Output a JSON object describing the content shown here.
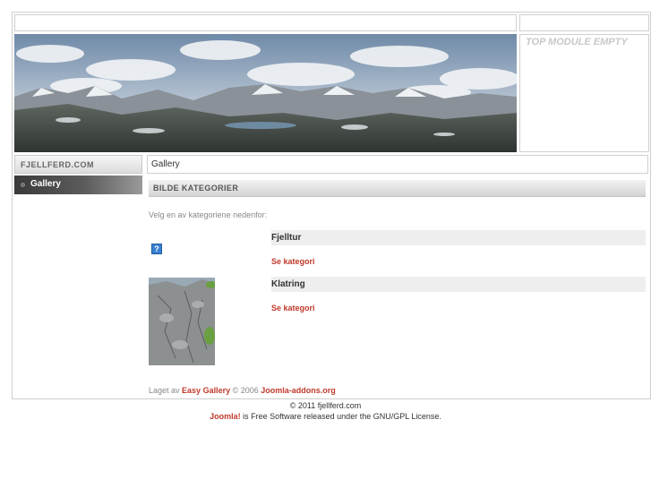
{
  "top_module": {
    "text": "TOP MODULE EMPTY"
  },
  "sidebar": {
    "header": "FJELLFERD.COM",
    "items": [
      {
        "label": "Gallery",
        "active": true
      }
    ]
  },
  "pathway": "Gallery",
  "gallery": {
    "header": "BILDE KATEGORIER",
    "intro": "Velg en av kategoriene nedenfor:",
    "categories": [
      {
        "name": "Fjelltur",
        "link": "Se kategori",
        "thumbnail": "missing-image-icon"
      },
      {
        "name": "Klatring",
        "link": "Se kategori",
        "thumbnail": "rock-climbing-photo"
      }
    ],
    "credit": {
      "prefix": "Laget av",
      "product": "Easy Gallery",
      "middle": "© 2006",
      "site": "Joomla-addons.org"
    }
  },
  "footer": {
    "copyright": "© 2011 fjellferd.com",
    "joomla": "Joomla!",
    "license": "is Free Software released under the GNU/GPL License."
  },
  "colors": {
    "link": "#c0392b",
    "muted": "#888888",
    "border": "#cfcfcf"
  }
}
